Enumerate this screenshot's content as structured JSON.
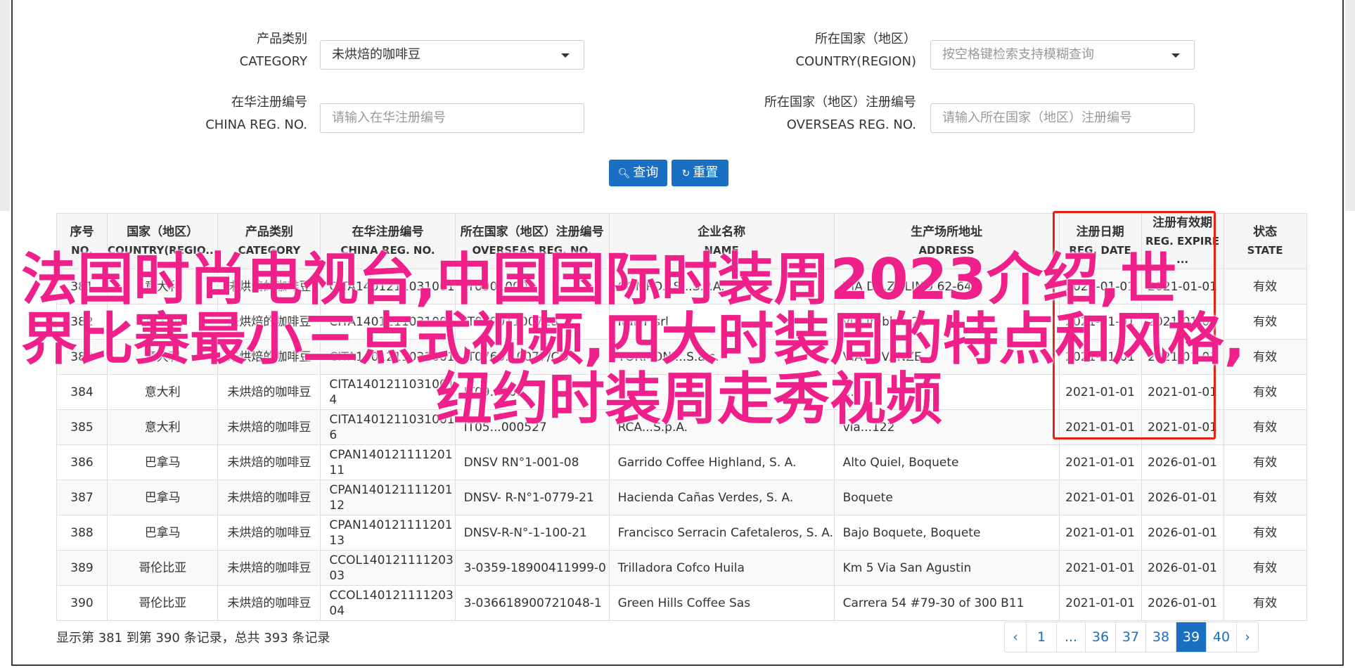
{
  "filters": {
    "category": {
      "label_cn": "产品类别",
      "label_en": "CATEGORY",
      "value": "未烘焙的咖啡豆"
    },
    "country": {
      "label_cn": "所在国家（地区）",
      "label_en": "COUNTRY(REGION)",
      "placeholder": "按空格键检索支持模糊查询"
    },
    "china_reg": {
      "label_cn": "在华注册编号",
      "label_en": "CHINA REG. NO.",
      "placeholder": "请输入在华注册编号"
    },
    "overseas_reg": {
      "label_cn": "所在国家（地区）注册编号",
      "label_en": "OVERSEAS REG. NO.",
      "placeholder": "请输入所在国家（地区）注册编号"
    }
  },
  "buttons": {
    "search": "查询",
    "reset": "重置"
  },
  "table": {
    "headers": [
      {
        "cn": "序号",
        "en": "NO."
      },
      {
        "cn": "国家（地区）",
        "en": "COUNTRY(REGIO..."
      },
      {
        "cn": "产品类别",
        "en": "CATEGORY"
      },
      {
        "cn": "在华注册编号",
        "en": "CHINA REG. NO."
      },
      {
        "cn": "所在国家（地区）注册编号",
        "en": "OVERSEAS REG. NO."
      },
      {
        "cn": "企业名称",
        "en": "NAME"
      },
      {
        "cn": "生产场所地址",
        "en": "ADDRESS"
      },
      {
        "cn": "注册日期",
        "en": "REG. DATE"
      },
      {
        "cn": "注册有效期",
        "en": "REG. EXPIRE ..."
      },
      {
        "cn": "状态",
        "en": "STATE"
      }
    ],
    "rows": [
      {
        "no": "381",
        "country": "意大利",
        "category": "未烘焙的咖啡豆",
        "china_reg": "CITA1401211031001",
        "overseas_reg": "IT09010000",
        "name": "COMPO...S...S.P.A.",
        "address": "VIA D...ZOLINO 62-64",
        "reg_date": "2021-01-01",
        "expire": "2021-01-01",
        "state": "有效"
      },
      {
        "no": "382",
        "country": "意大利",
        "category": "未烘焙的咖啡豆",
        "china_reg": "CITA1401211031001",
        "overseas_reg": "IT05901100718",
        "name": "Italvi' srl",
        "address": "via Trebbia 21",
        "reg_date": "2021-01-01",
        "expire": "2021-01-01",
        "state": "有效"
      },
      {
        "no": "383",
        "country": "意大利",
        "category": "未烘焙的咖啡豆",
        "china_reg": "CITA1401211031001",
        "overseas_reg": "IT0760...0077/CO",
        "name": "TORMONI...S.a.s.",
        "address": "VIA...EVANZE",
        "reg_date": "2021-01-01",
        "expire": "2021-01-01",
        "state": "有效"
      },
      {
        "no": "384",
        "country": "意大利",
        "category": "未烘焙的咖啡豆",
        "china_reg": "CITA1401211031001\n4",
        "overseas_reg": "IT09...00...",
        "name": "",
        "address": "...",
        "reg_date": "2021-01-01",
        "expire": "2021-01-01",
        "state": "有效"
      },
      {
        "no": "385",
        "country": "意大利",
        "category": "未烘焙的咖啡豆",
        "china_reg": "CITA1401211031001\n6",
        "overseas_reg": "IT05...000527",
        "name": "RCA...S.p.A.",
        "address": "via...122",
        "reg_date": "2021-01-01",
        "expire": "2021-01-01",
        "state": "有效"
      },
      {
        "no": "386",
        "country": "巴拿马",
        "category": "未烘焙的咖啡豆",
        "china_reg": "CPAN140121111201\n11",
        "overseas_reg": "DNSV RN°1-001-08",
        "name": "Garrido Coffee Highland, S. A.",
        "address": "Alto Quiel, Boquete",
        "reg_date": "2021-01-01",
        "expire": "2026-01-01",
        "state": "有效"
      },
      {
        "no": "387",
        "country": "巴拿马",
        "category": "未烘焙的咖啡豆",
        "china_reg": "CPAN140121111201\n12",
        "overseas_reg": "DNSV- R-N°1-0779-21",
        "name": "Hacienda Cañas Verdes, S. A.",
        "address": "Boquete",
        "reg_date": "2021-01-01",
        "expire": "2026-01-01",
        "state": "有效"
      },
      {
        "no": "388",
        "country": "巴拿马",
        "category": "未烘焙的咖啡豆",
        "china_reg": "CPAN140121111201\n13",
        "overseas_reg": "DNSV-R-N°-1-100-21",
        "name": "Francisco Serracin Cafetaleros, S. A.",
        "address": "Bajo Boquete, Boquete",
        "reg_date": "2021-01-01",
        "expire": "2026-01-01",
        "state": "有效"
      },
      {
        "no": "389",
        "country": "哥伦比亚",
        "category": "未烘焙的咖啡豆",
        "china_reg": "CCOL140121111203\n03",
        "overseas_reg": "3-0359-18900411999-0",
        "name": "Trilladora Cofco Huila",
        "address": "Km 5 Via San Agustin",
        "reg_date": "2021-01-01",
        "expire": "2026-01-01",
        "state": "有效"
      },
      {
        "no": "390",
        "country": "哥伦比亚",
        "category": "未烘焙的咖啡豆",
        "china_reg": "CCOL140121111203\n04",
        "overseas_reg": "3-036618900721048-1",
        "name": "Green Hills Coffee Sas",
        "address": "Carrera 54 #79-30 of 300 B11",
        "reg_date": "2021-01-01",
        "expire": "2026-01-01",
        "state": "有效"
      }
    ]
  },
  "overlay": {
    "line1": "法国时尚电视台,中国国际时装周2023介绍,世",
    "line2": "界比赛最小三点式视频,四大时装周的特点和风格,",
    "line3": "纽约时装周走秀视频"
  },
  "summary": "显示第 381 到第 390 条记录，总共 393 条记录",
  "pager": [
    "‹",
    "1",
    "...",
    "36",
    "37",
    "38",
    "39",
    "40",
    "›"
  ],
  "pager_active": "39",
  "colors": {
    "primary": "#1a6fc2",
    "highlight": "#e2231a",
    "overlay_text": "#f0208a"
  }
}
